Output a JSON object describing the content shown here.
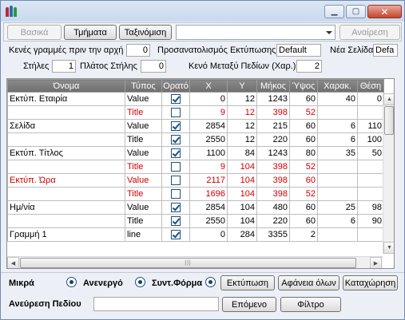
{
  "window": {
    "icon": "books-app-icon",
    "controls": {
      "minimize": "▁",
      "maximize": "▢",
      "close": "✕"
    }
  },
  "toolbar": {
    "basic_label": "Βασικά",
    "sections_label": "Τμήματα",
    "sort_label": "Ταξινόμιση",
    "combo_value": "",
    "undo_label": "Αναίρεση"
  },
  "settings": {
    "empty_lines_label": "Κενές γραμμές πριν την αρχή",
    "empty_lines_value": "0",
    "print_orientation_label": "Προσανατολισμός Εκτύπωσης",
    "print_orientation_value": "Default",
    "new_page_label": "Νέα Σελίδα",
    "new_page_value": "Defa",
    "columns_label": "Στήλες",
    "columns_value": "1",
    "column_width_label": "Πλάτος Στήλης",
    "column_width_value": "0",
    "field_gap_label": "Κενό Μεταξύ Πεδίων (Χαρ.)",
    "field_gap_value": "2"
  },
  "grid": {
    "headers": [
      "Όνομα",
      "Τύπος",
      "Ορατό",
      "Χ",
      "Υ",
      "Μήκος",
      "Ύψος",
      "Χαρακ.",
      "Θέση"
    ],
    "rows": [
      {
        "name": "Εκτύπ. Εταιρία",
        "type": "Value",
        "visible": true,
        "x": "0",
        "y": "12",
        "length": "1243",
        "height": "60",
        "chars": "40",
        "pos": "0",
        "red": false
      },
      {
        "name": "",
        "type": "Title",
        "visible": false,
        "x": "9",
        "y": "12",
        "length": "398",
        "height": "52",
        "chars": "",
        "pos": "",
        "red": true
      },
      {
        "name": "Σελίδα",
        "type": "Value",
        "visible": true,
        "x": "2854",
        "y": "12",
        "length": "215",
        "height": "60",
        "chars": "6",
        "pos": "110",
        "red": false
      },
      {
        "name": "",
        "type": "Title",
        "visible": true,
        "x": "2550",
        "y": "12",
        "length": "220",
        "height": "60",
        "chars": "6",
        "pos": "100",
        "red": false
      },
      {
        "name": "Εκτύπ. Τίτλος",
        "type": "Value",
        "visible": true,
        "x": "1100",
        "y": "84",
        "length": "1243",
        "height": "80",
        "chars": "35",
        "pos": "50",
        "red": false
      },
      {
        "name": "",
        "type": "Title",
        "visible": false,
        "x": "9",
        "y": "104",
        "length": "398",
        "height": "52",
        "chars": "",
        "pos": "",
        "red": true
      },
      {
        "name": "Εκτύπ. Ώρα",
        "type": "Value",
        "visible": false,
        "x": "2117",
        "y": "104",
        "length": "398",
        "height": "60",
        "chars": "",
        "pos": "",
        "red": true
      },
      {
        "name": "",
        "type": "Title",
        "visible": false,
        "x": "1696",
        "y": "104",
        "length": "398",
        "height": "52",
        "chars": "",
        "pos": "",
        "red": true
      },
      {
        "name": "Ημ/νία",
        "type": "Value",
        "visible": true,
        "x": "2854",
        "y": "104",
        "length": "480",
        "height": "60",
        "chars": "25",
        "pos": "98",
        "red": false
      },
      {
        "name": "",
        "type": "Title",
        "visible": true,
        "x": "2550",
        "y": "104",
        "length": "220",
        "height": "60",
        "chars": "6",
        "pos": "90",
        "red": false
      },
      {
        "name": "Γραμμή 1",
        "type": "line",
        "visible": true,
        "x": "0",
        "y": "284",
        "length": "3355",
        "height": "2",
        "chars": "",
        "pos": "",
        "red": false
      }
    ]
  },
  "footer": {
    "small_label": "Μικρά",
    "inactive_label": "Ανενεργό",
    "sync_form_label": "Συντ.Φόρμα",
    "print_button": "Εκτύπωση",
    "clear_all_button": "Αφάνεια όλων",
    "save_button": "Καταχώρηση",
    "find_field_label": "Ανεύρεση Πεδίου",
    "find_field_value": "",
    "next_button": "Επόμενο",
    "filter_button": "Φίλτρο"
  },
  "colors": {
    "accent": "#1c5180",
    "hidden_row_text": "#d00000",
    "header_bg": "#7a7a7a"
  }
}
